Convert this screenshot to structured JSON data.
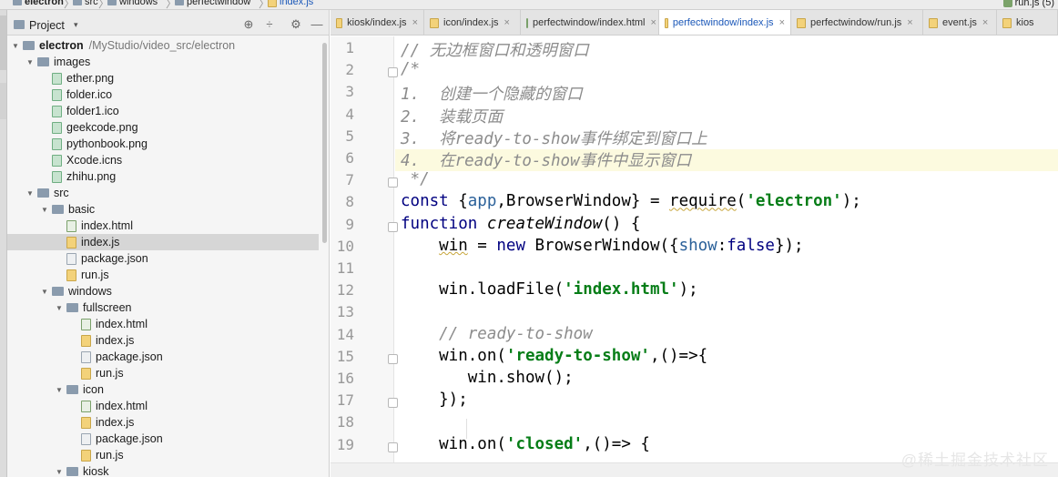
{
  "breadcrumb": {
    "items": [
      "electron",
      "src",
      "windows",
      "perfectwindow",
      "index.js"
    ],
    "run_config": "run.js (5)"
  },
  "project_panel": {
    "title": "Project",
    "caret": "▾",
    "buttons": [
      "⊕",
      "÷",
      "⚙",
      "—"
    ],
    "tree": [
      {
        "name": "electron",
        "path": "/MyStudio/video_src/electron",
        "type": "folder",
        "depth": 0,
        "expanded": true
      },
      {
        "name": "images",
        "type": "folder",
        "depth": 1,
        "expanded": true
      },
      {
        "name": "ether.png",
        "type": "img",
        "depth": 2
      },
      {
        "name": "folder.ico",
        "type": "img",
        "depth": 2
      },
      {
        "name": "folder1.ico",
        "type": "img",
        "depth": 2
      },
      {
        "name": "geekcode.png",
        "type": "img",
        "depth": 2
      },
      {
        "name": "pythonbook.png",
        "type": "img",
        "depth": 2
      },
      {
        "name": "Xcode.icns",
        "type": "img",
        "depth": 2
      },
      {
        "name": "zhihu.png",
        "type": "img",
        "depth": 2
      },
      {
        "name": "src",
        "type": "folder",
        "depth": 1,
        "expanded": true
      },
      {
        "name": "basic",
        "type": "folder",
        "depth": 2,
        "expanded": true
      },
      {
        "name": "index.html",
        "type": "html",
        "depth": 3
      },
      {
        "name": "index.js",
        "type": "js",
        "depth": 3,
        "selected": true
      },
      {
        "name": "package.json",
        "type": "json",
        "depth": 3
      },
      {
        "name": "run.js",
        "type": "js",
        "depth": 3
      },
      {
        "name": "windows",
        "type": "folder",
        "depth": 2,
        "expanded": true
      },
      {
        "name": "fullscreen",
        "type": "folder",
        "depth": 3,
        "expanded": true
      },
      {
        "name": "index.html",
        "type": "html",
        "depth": 4
      },
      {
        "name": "index.js",
        "type": "js",
        "depth": 4
      },
      {
        "name": "package.json",
        "type": "json",
        "depth": 4
      },
      {
        "name": "run.js",
        "type": "js",
        "depth": 4
      },
      {
        "name": "icon",
        "type": "folder",
        "depth": 3,
        "expanded": true
      },
      {
        "name": "index.html",
        "type": "html",
        "depth": 4
      },
      {
        "name": "index.js",
        "type": "js",
        "depth": 4
      },
      {
        "name": "package.json",
        "type": "json",
        "depth": 4
      },
      {
        "name": "run.js",
        "type": "js",
        "depth": 4
      },
      {
        "name": "kiosk",
        "type": "folder",
        "depth": 3,
        "expanded": true
      }
    ]
  },
  "tabs": [
    {
      "label": "kiosk/index.js",
      "type": "js",
      "active": false
    },
    {
      "label": "icon/index.js",
      "type": "js",
      "active": false
    },
    {
      "label": "perfectwindow/index.html",
      "type": "html",
      "active": false
    },
    {
      "label": "perfectwindow/index.js",
      "type": "js",
      "active": true
    },
    {
      "label": "perfectwindow/run.js",
      "type": "js",
      "active": false
    },
    {
      "label": "event.js",
      "type": "js",
      "active": false
    },
    {
      "label": "kios",
      "type": "js",
      "active": false
    }
  ],
  "editor": {
    "highlighted_line": 6,
    "line_numbers": [
      "1",
      "2",
      "3",
      "4",
      "5",
      "6",
      "7",
      "8",
      "9",
      "10",
      "11",
      "12",
      "13",
      "14",
      "15",
      "16",
      "17",
      "18",
      "19"
    ],
    "lines": [
      "// 无边框窗口和透明窗口",
      "/*",
      "1.  创建一个隐藏的窗口",
      "2.  装载页面",
      "3.  将ready-to-show事件绑定到窗口上",
      "4.  在ready-to-show事件中显示窗口",
      " */",
      "const {app,BrowserWindow} = require('electron');",
      "function createWindow() {",
      "    win = new BrowserWindow({show:false});",
      "",
      "    win.loadFile('index.html');",
      "",
      "    // ready-to-show",
      "    win.on('ready-to-show',()=>{",
      "       win.show();",
      "    });",
      "",
      "    win.on('closed',()=> {"
    ]
  },
  "watermark": "@稀土掘金技术社区"
}
